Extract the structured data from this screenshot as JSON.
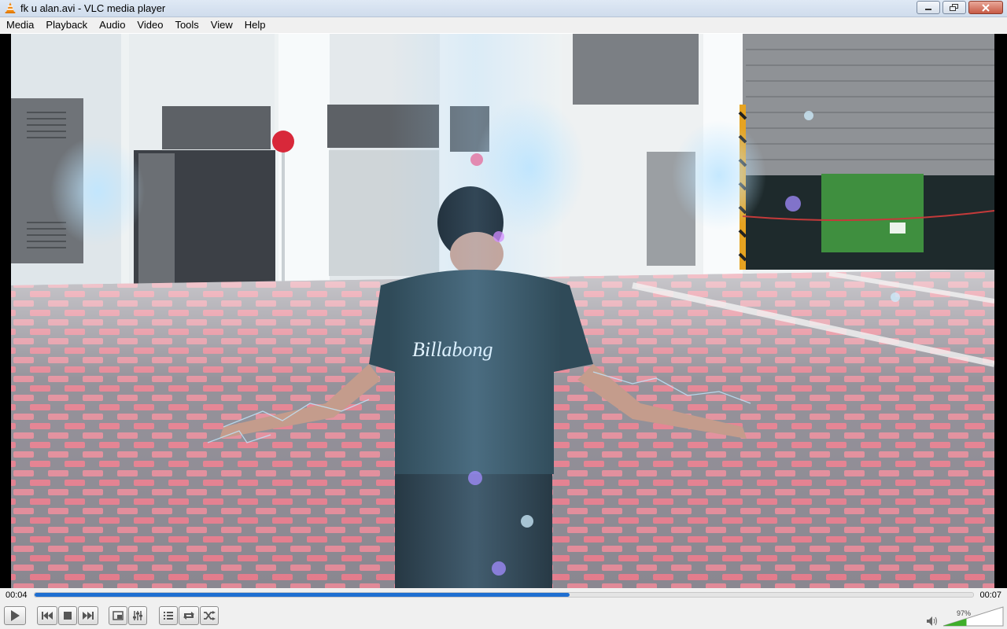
{
  "window": {
    "title": "fk u alan.avi - VLC media player"
  },
  "menu": {
    "items": [
      "Media",
      "Playback",
      "Audio",
      "Video",
      "Tools",
      "View",
      "Help"
    ]
  },
  "playback": {
    "current_time": "00:04",
    "total_time": "00:07",
    "progress": 0.57
  },
  "volume": {
    "label": "97%",
    "level": 0.97
  },
  "icons": {
    "app": "vlc-cone-icon",
    "minimize": "minimize-icon",
    "restore": "restore-icon",
    "close": "close-icon",
    "play": "play-icon",
    "previous": "skip-previous-icon",
    "stop": "stop-icon",
    "next": "skip-next-icon",
    "fullscreen": "fullscreen-icon",
    "extended": "equalizer-sliders-icon",
    "playlist": "playlist-icon",
    "loop": "loop-icon",
    "shuffle": "shuffle-icon",
    "speaker": "speaker-icon"
  },
  "colors": {
    "accent": "#1f6fd1",
    "volume_green": "#3fae2a"
  }
}
